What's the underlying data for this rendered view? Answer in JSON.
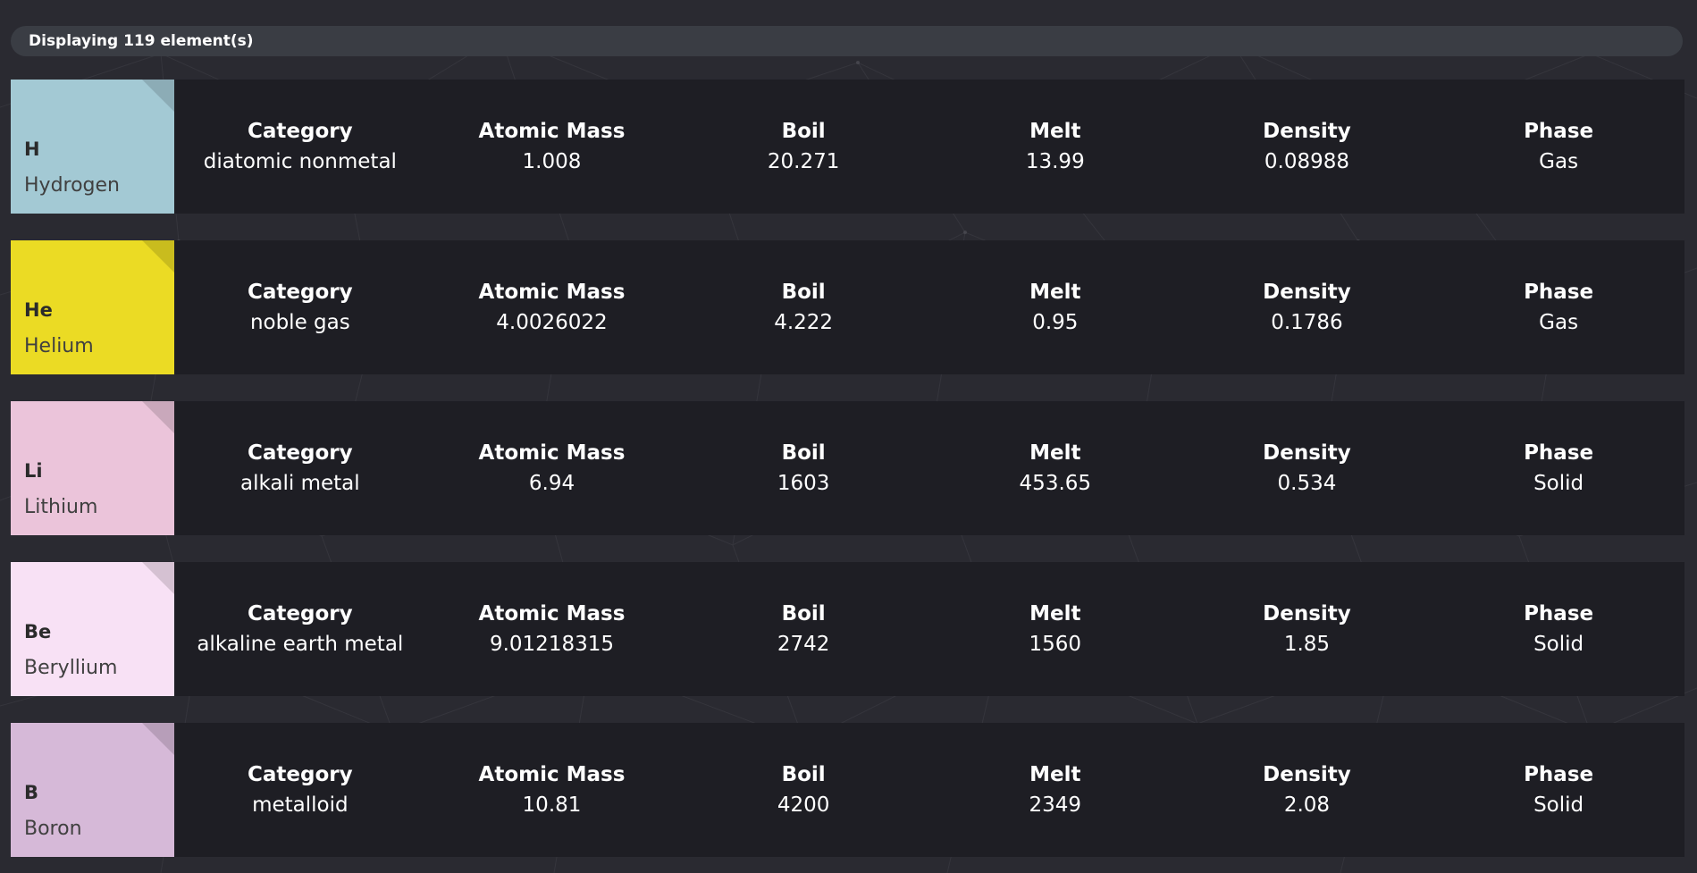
{
  "header": {
    "counter_text": "Displaying 119 element(s)"
  },
  "labels": {
    "category": "Category",
    "atomic_mass": "Atomic Mass",
    "boil": "Boil",
    "melt": "Melt",
    "density": "Density",
    "phase": "Phase"
  },
  "elements": [
    {
      "symbol": "H",
      "name": "Hydrogen",
      "color": "#a3c9d4",
      "category": "diatomic nonmetal",
      "atomic_mass": "1.008",
      "boil": "20.271",
      "melt": "13.99",
      "density": "0.08988",
      "phase": "Gas"
    },
    {
      "symbol": "He",
      "name": "Helium",
      "color": "#ebdb24",
      "category": "noble gas",
      "atomic_mass": "4.0026022",
      "boil": "4.222",
      "melt": "0.95",
      "density": "0.1786",
      "phase": "Gas"
    },
    {
      "symbol": "Li",
      "name": "Lithium",
      "color": "#ebc4da",
      "category": "alkali metal",
      "atomic_mass": "6.94",
      "boil": "1603",
      "melt": "453.65",
      "density": "0.534",
      "phase": "Solid"
    },
    {
      "symbol": "Be",
      "name": "Beryllium",
      "color": "#f8e1f5",
      "category": "alkaline earth metal",
      "atomic_mass": "9.01218315",
      "boil": "2742",
      "melt": "1560",
      "density": "1.85",
      "phase": "Solid"
    },
    {
      "symbol": "B",
      "name": "Boron",
      "color": "#d6b9d8",
      "category": "metalloid",
      "atomic_mass": "10.81",
      "boil": "4200",
      "melt": "2349",
      "density": "2.08",
      "phase": "Solid"
    }
  ]
}
